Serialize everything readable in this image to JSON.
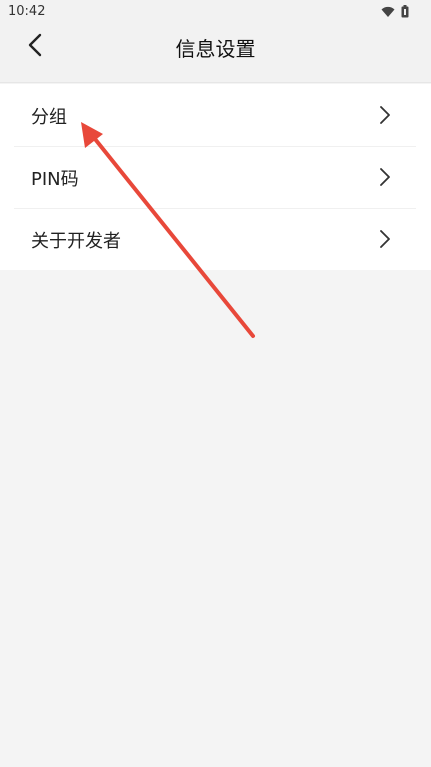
{
  "status_bar": {
    "time": "10:42",
    "icons": [
      "wifi-icon",
      "battery-icon"
    ]
  },
  "header": {
    "title": "信息设置",
    "back_icon": "chevron-left-icon"
  },
  "menu": {
    "items": [
      {
        "label": "分组",
        "icon": "chevron-right-icon"
      },
      {
        "label": "PIN码",
        "icon": "chevron-right-icon"
      },
      {
        "label": "关于开发者",
        "icon": "chevron-right-icon"
      }
    ]
  },
  "colors": {
    "background": "#f4f4f4",
    "list_background": "#ffffff",
    "annotation_arrow": "#e8483a"
  }
}
